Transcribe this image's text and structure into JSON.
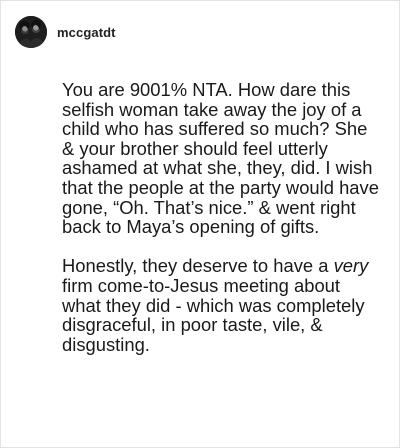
{
  "post": {
    "username": "mccgatdt",
    "avatar_icon": "profile-avatar-icon",
    "paragraphs": [
      "You are 9001% NTA. How dare this selfish woman take away the joy of a child who has suffered so much? She & your brother should feel utterly ashamed at what she, they, did. I wish that the people at the party would have gone, “Oh. That’s nice.” & went right back to Maya’s opening of gifts."
    ],
    "paragraph2": {
      "before": "Honestly, they deserve to have a ",
      "emphasis": "very",
      "after": " firm come-to-Jesus meeting about what they did - which was completely disgraceful, in poor taste, vile, & disgusting."
    }
  },
  "colors": {
    "text": "#1a1a1a",
    "username": "#222222",
    "border": "#e3e3e3",
    "background": "#ffffff"
  }
}
